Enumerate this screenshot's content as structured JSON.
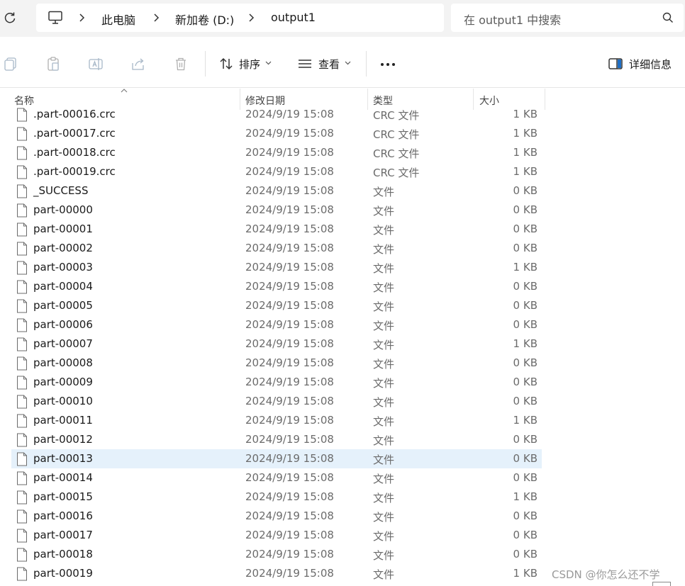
{
  "breadcrumb": {
    "items": [
      "此电脑",
      "新加卷 (D:)",
      "output1"
    ]
  },
  "search": {
    "placeholder": "在 output1 中搜索"
  },
  "toolbar": {
    "sort_label": "排序",
    "view_label": "查看",
    "details_label": "详细信息"
  },
  "columns": {
    "name": "名称",
    "date": "修改日期",
    "type": "类型",
    "size": "大小"
  },
  "files": [
    {
      "name": ".part-00016.crc",
      "date": "2024/9/19 15:08",
      "type": "CRC 文件",
      "size": "1 KB"
    },
    {
      "name": ".part-00017.crc",
      "date": "2024/9/19 15:08",
      "type": "CRC 文件",
      "size": "1 KB"
    },
    {
      "name": ".part-00018.crc",
      "date": "2024/9/19 15:08",
      "type": "CRC 文件",
      "size": "1 KB"
    },
    {
      "name": ".part-00019.crc",
      "date": "2024/9/19 15:08",
      "type": "CRC 文件",
      "size": "1 KB"
    },
    {
      "name": "_SUCCESS",
      "date": "2024/9/19 15:08",
      "type": "文件",
      "size": "0 KB"
    },
    {
      "name": "part-00000",
      "date": "2024/9/19 15:08",
      "type": "文件",
      "size": "0 KB"
    },
    {
      "name": "part-00001",
      "date": "2024/9/19 15:08",
      "type": "文件",
      "size": "0 KB"
    },
    {
      "name": "part-00002",
      "date": "2024/9/19 15:08",
      "type": "文件",
      "size": "0 KB"
    },
    {
      "name": "part-00003",
      "date": "2024/9/19 15:08",
      "type": "文件",
      "size": "1 KB"
    },
    {
      "name": "part-00004",
      "date": "2024/9/19 15:08",
      "type": "文件",
      "size": "0 KB"
    },
    {
      "name": "part-00005",
      "date": "2024/9/19 15:08",
      "type": "文件",
      "size": "0 KB"
    },
    {
      "name": "part-00006",
      "date": "2024/9/19 15:08",
      "type": "文件",
      "size": "0 KB"
    },
    {
      "name": "part-00007",
      "date": "2024/9/19 15:08",
      "type": "文件",
      "size": "1 KB"
    },
    {
      "name": "part-00008",
      "date": "2024/9/19 15:08",
      "type": "文件",
      "size": "0 KB"
    },
    {
      "name": "part-00009",
      "date": "2024/9/19 15:08",
      "type": "文件",
      "size": "0 KB"
    },
    {
      "name": "part-00010",
      "date": "2024/9/19 15:08",
      "type": "文件",
      "size": "0 KB"
    },
    {
      "name": "part-00011",
      "date": "2024/9/19 15:08",
      "type": "文件",
      "size": "1 KB"
    },
    {
      "name": "part-00012",
      "date": "2024/9/19 15:08",
      "type": "文件",
      "size": "0 KB"
    },
    {
      "name": "part-00013",
      "date": "2024/9/19 15:08",
      "type": "文件",
      "size": "0 KB",
      "selected": true
    },
    {
      "name": "part-00014",
      "date": "2024/9/19 15:08",
      "type": "文件",
      "size": "0 KB"
    },
    {
      "name": "part-00015",
      "date": "2024/9/19 15:08",
      "type": "文件",
      "size": "1 KB"
    },
    {
      "name": "part-00016",
      "date": "2024/9/19 15:08",
      "type": "文件",
      "size": "0 KB"
    },
    {
      "name": "part-00017",
      "date": "2024/9/19 15:08",
      "type": "文件",
      "size": "0 KB"
    },
    {
      "name": "part-00018",
      "date": "2024/9/19 15:08",
      "type": "文件",
      "size": "0 KB"
    },
    {
      "name": "part-00019",
      "date": "2024/9/19 15:08",
      "type": "文件",
      "size": "1 KB"
    }
  ],
  "watermark": "CSDN @你怎么还不学"
}
